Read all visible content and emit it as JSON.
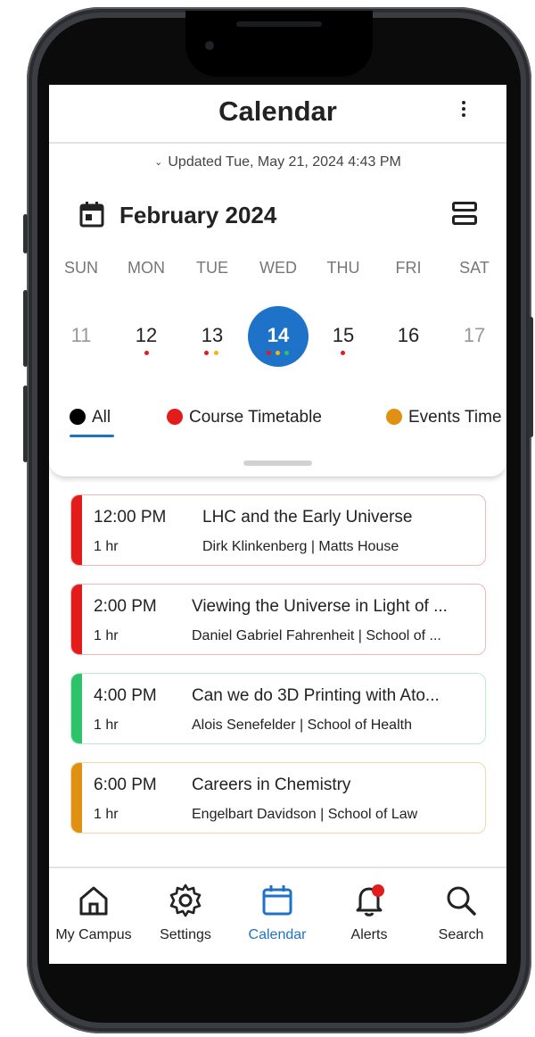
{
  "header": {
    "title": "Calendar"
  },
  "updated_text": "Updated Tue, May 21, 2024 4:43 PM",
  "month_label": "February 2024",
  "weekdays": [
    "SUN",
    "MON",
    "TUE",
    "WED",
    "THU",
    "FRI",
    "SAT"
  ],
  "days": [
    "11",
    "12",
    "13",
    "14",
    "15",
    "16",
    "17"
  ],
  "selected_day": "14",
  "filters": [
    {
      "label": "All",
      "color": "#000000"
    },
    {
      "label": "Course Timetable",
      "color": "#e21b1b"
    },
    {
      "label": "Events Time",
      "color": "#e09112"
    }
  ],
  "events": [
    {
      "time": "12:00 PM",
      "duration": "1 hr",
      "title": "LHC and the Early Universe",
      "meta": "Dirk Klinkenberg | Matts House",
      "color": "#e21b1b"
    },
    {
      "time": "2:00 PM",
      "duration": "1 hr",
      "title": "Viewing the Universe in Light of ...",
      "meta": "Daniel Gabriel Fahrenheit | School of ...",
      "color": "#e21b1b"
    },
    {
      "time": "4:00 PM",
      "duration": "1 hr",
      "title": "Can we do 3D Printing with Ato...",
      "meta": "Alois Senefelder | School of Health",
      "color": "#2cc36b"
    },
    {
      "time": "6:00 PM",
      "duration": "1 hr",
      "title": "Careers in Chemistry",
      "meta": "Engelbart Davidson | School of Law",
      "color": "#e09112"
    }
  ],
  "nav": [
    {
      "label": "My Campus",
      "icon": "home-icon"
    },
    {
      "label": "Settings",
      "icon": "gear-icon"
    },
    {
      "label": "Calendar",
      "icon": "calendar-icon"
    },
    {
      "label": "Alerts",
      "icon": "bell-icon"
    },
    {
      "label": "Search",
      "icon": "search-icon"
    }
  ],
  "colors": {
    "accent": "#1e73c8",
    "course": "#e21b1b",
    "events": "#e09112",
    "workshop": "#2cc36b"
  }
}
